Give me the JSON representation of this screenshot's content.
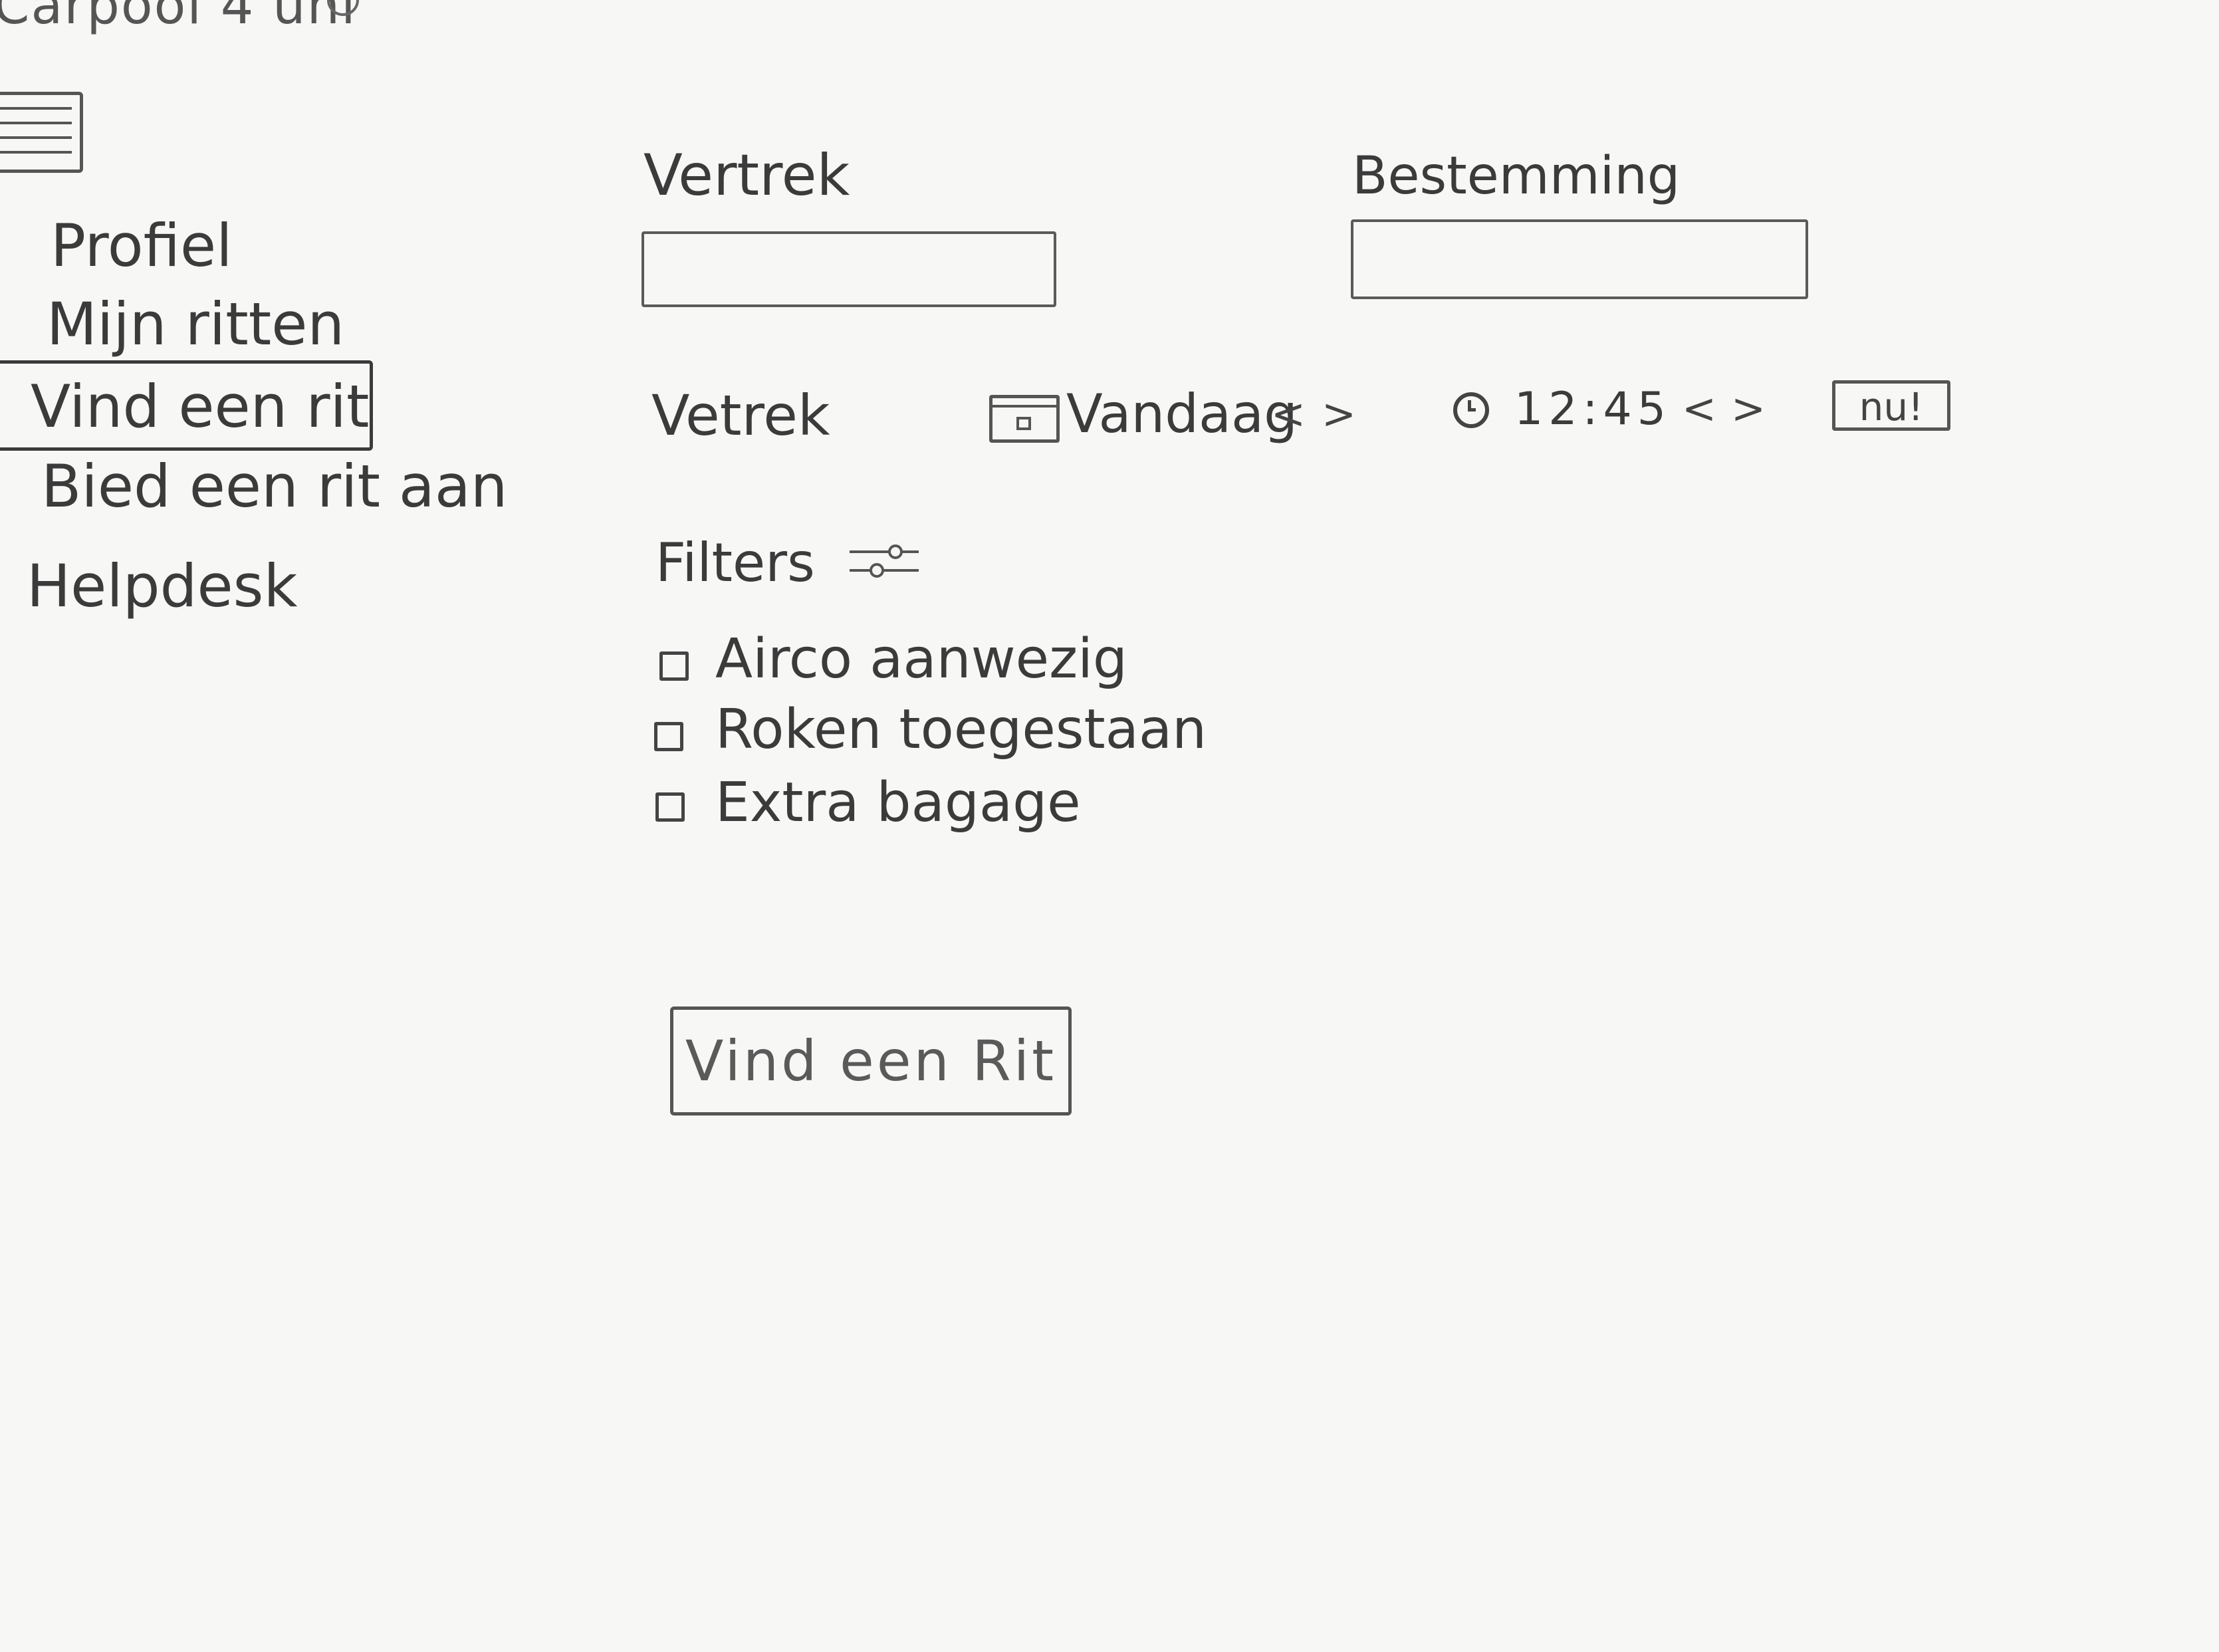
{
  "app": {
    "title": "Carpool 4 uni"
  },
  "sidebar": {
    "items": [
      {
        "label": "Profiel"
      },
      {
        "label": "Mijn ritten"
      },
      {
        "label": "Vind een rit",
        "active": true
      },
      {
        "label": "Bied een rit aan"
      },
      {
        "label": "Helpdesk"
      }
    ]
  },
  "route": {
    "departure_label": "Vertrek",
    "departure_value": "",
    "destination_label": "Bestemming",
    "destination_value": ""
  },
  "datetime": {
    "label": "Vetrek",
    "date": "Vandaag",
    "time": "12:45",
    "prev_glyph": "<",
    "next_glyph": ">",
    "now_label": "nu!"
  },
  "filters": {
    "label": "Filters",
    "options": [
      {
        "label": "Airco aanwezig",
        "checked": false
      },
      {
        "label": "Roken toegestaan",
        "checked": false
      },
      {
        "label": "Extra bagage",
        "checked": false
      }
    ]
  },
  "submit": {
    "label": "Vind een Rit"
  },
  "icons": {
    "menu": "hamburger-menu-icon",
    "calendar": "calendar-icon",
    "clock": "clock-icon",
    "filters": "sliders-icon"
  }
}
